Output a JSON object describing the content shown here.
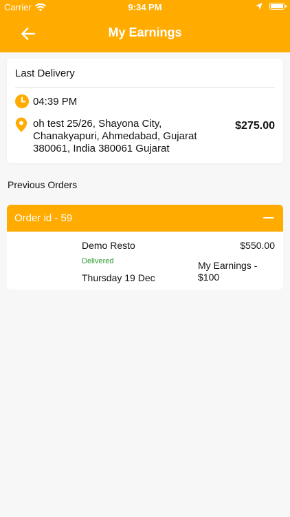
{
  "status_bar": {
    "carrier": "Carrier",
    "time": "9:34 PM",
    "battery_level": 1.0
  },
  "header": {
    "title": "My Earnings",
    "back_icon": "arrow-left-icon"
  },
  "last_delivery": {
    "title": "Last Delivery",
    "time": "04:39 PM",
    "address": "oh test 25/26, Shayona City, Chanakyapuri, Ahmedabad, Gujarat 380061, India 380061 Gujarat",
    "amount": "$275.00",
    "time_icon": "clock-icon",
    "address_icon": "location-pin-icon"
  },
  "previous_orders": {
    "title": "Previous Orders",
    "orders": [
      {
        "order_id": "Order id - 59",
        "restaurant": "Demo Resto",
        "status": "Delivered",
        "date": "Thursday 19 Dec",
        "total": "$550.00",
        "earnings": "My Earnings - $100",
        "collapse_icon": "minus-icon"
      }
    ]
  },
  "colors": {
    "accent": "#ffab00",
    "status_delivered": "#2b9b2b",
    "background": "#f7f7f7",
    "card": "#ffffff"
  }
}
